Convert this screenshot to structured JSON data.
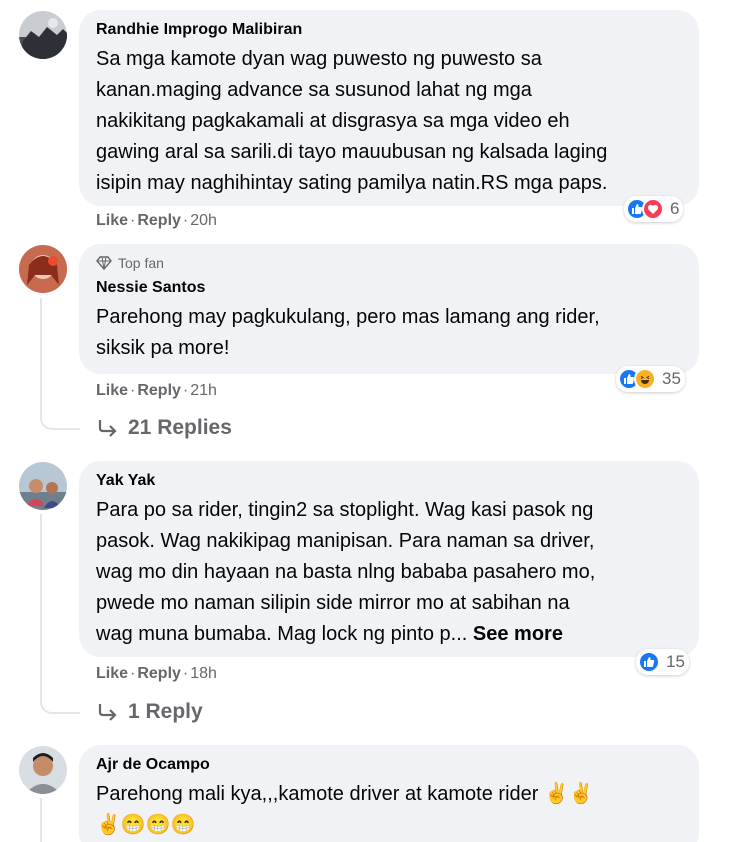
{
  "comments": [
    {
      "author": "Randhie Improgo Malibiran",
      "lines": [
        "Sa mga kamote dyan wag puwesto ng puwesto sa",
        "kanan.maging advance sa susunod lahat ng mga",
        "nakikitang pagkakamali at disgrasya sa mga video eh",
        "gawing aral sa sarili.di tayo mauubusan ng kalsada laging",
        "isipin may naghihintay sating pamilya natin.RS mga paps."
      ],
      "like": "Like",
      "reply": "Reply",
      "time": "20h",
      "reaction_icons": [
        "like-icon",
        "love-icon"
      ],
      "reaction_count": "6"
    },
    {
      "badge": "Top fan",
      "author": "Nessie Santos",
      "lines": [
        "Parehong may pagkukulang, pero mas lamang ang rider,",
        "siksik pa more!"
      ],
      "like": "Like",
      "reply": "Reply",
      "time": "21h",
      "reaction_icons": [
        "like-icon",
        "haha-icon"
      ],
      "reaction_count": "35",
      "replies_label": "21 Replies"
    },
    {
      "author": "Yak Yak",
      "lines": [
        "Para po sa rider, tingin2 sa stoplight. Wag kasi pasok ng",
        "pasok. Wag nakikipag manipisan. Para naman sa driver,",
        "wag mo din hayaan na basta nlng bababa pasahero mo,",
        "pwede mo naman silipin side mirror mo at sabihan na",
        "wag muna bumaba. Mag lock ng pinto p..."
      ],
      "see_more": "See more",
      "like": "Like",
      "reply": "Reply",
      "time": "18h",
      "reaction_icons": [
        "like-icon"
      ],
      "reaction_count": "15",
      "replies_label": "1 Reply"
    },
    {
      "author": "Ajr de Ocampo",
      "lines": [
        "Parehong mali kya,,,kamote driver at kamote rider ✌️✌️",
        "✌️😁😁😁"
      ]
    }
  ],
  "colors": {
    "bubble": "#f0f2f5",
    "meta": "#65676b",
    "like_blue": "#1877f2",
    "love_red": "#f33e58",
    "haha_yellow": "#f7b125"
  }
}
